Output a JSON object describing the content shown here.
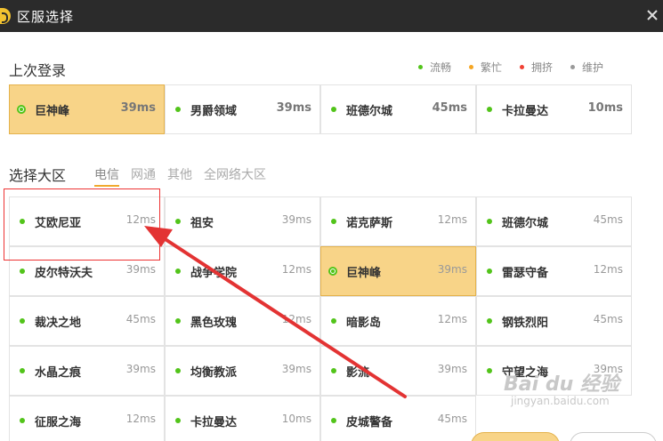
{
  "window": {
    "title": "区服选择"
  },
  "last_login": {
    "heading": "上次登录",
    "servers": [
      {
        "name": "巨神峰",
        "ping": "39ms",
        "selected": true
      },
      {
        "name": "男爵领域",
        "ping": "39ms",
        "selected": false
      },
      {
        "name": "班德尔城",
        "ping": "45ms",
        "selected": false
      },
      {
        "name": "卡拉曼达",
        "ping": "10ms",
        "selected": false
      }
    ]
  },
  "legend": [
    {
      "label": "流畅",
      "color": "#52c41a"
    },
    {
      "label": "繁忙",
      "color": "#f5a623"
    },
    {
      "label": "拥挤",
      "color": "#f04134"
    },
    {
      "label": "维护",
      "color": "#999999"
    }
  ],
  "region": {
    "heading": "选择大区",
    "tabs": [
      {
        "label": "电信",
        "active": true
      },
      {
        "label": "网通",
        "active": false
      },
      {
        "label": "其他",
        "active": false
      },
      {
        "label": "全网络大区",
        "active": false
      }
    ],
    "servers": [
      {
        "name": "艾欧尼亚",
        "ping": "12ms",
        "selected": false
      },
      {
        "name": "祖安",
        "ping": "39ms",
        "selected": false
      },
      {
        "name": "诺克萨斯",
        "ping": "12ms",
        "selected": false
      },
      {
        "name": "班德尔城",
        "ping": "45ms",
        "selected": false
      },
      {
        "name": "皮尔特沃夫",
        "ping": "39ms",
        "selected": false
      },
      {
        "name": "战争学院",
        "ping": "12ms",
        "selected": false
      },
      {
        "name": "巨神峰",
        "ping": "39ms",
        "selected": true
      },
      {
        "name": "雷瑟守备",
        "ping": "12ms",
        "selected": false
      },
      {
        "name": "裁决之地",
        "ping": "45ms",
        "selected": false
      },
      {
        "name": "黑色玫瑰",
        "ping": "12ms",
        "selected": false
      },
      {
        "name": "暗影岛",
        "ping": "12ms",
        "selected": false
      },
      {
        "name": "钢铁烈阳",
        "ping": "45ms",
        "selected": false
      },
      {
        "name": "水晶之痕",
        "ping": "39ms",
        "selected": false
      },
      {
        "name": "均衡教派",
        "ping": "39ms",
        "selected": false
      },
      {
        "name": "影流",
        "ping": "39ms",
        "selected": false
      },
      {
        "name": "守望之海",
        "ping": "39ms",
        "selected": false
      },
      {
        "name": "征服之海",
        "ping": "12ms",
        "selected": false
      },
      {
        "name": "卡拉曼达",
        "ping": "10ms",
        "selected": false
      },
      {
        "name": "皮城警备",
        "ping": "45ms",
        "selected": false
      }
    ]
  },
  "watermark": {
    "logo": "Bai du 经验",
    "url": "jingyan.baidu.com"
  },
  "colors": {
    "titlebar": "#2b2b2b",
    "selected": "#f8d488",
    "accent": "#f0a92e",
    "annotation": "#e33333"
  }
}
